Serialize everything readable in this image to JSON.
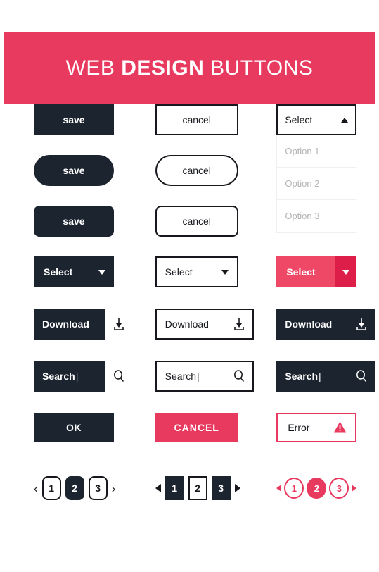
{
  "colors": {
    "pink": "#e8395f",
    "pink_light": "#ef4866",
    "pink_dark": "#dd1e48",
    "dark": "#1c2430",
    "outline": "#16181d",
    "option_text": "#b4b4b4",
    "white": "#ffffff"
  },
  "banner": {
    "title_part1": "WEB ",
    "title_part2": "DESIGN",
    "title_part3": " BUTTONS"
  },
  "buttons": {
    "save_label": "save",
    "cancel_label": "cancel",
    "select_label": "Select",
    "download_label": "Download",
    "search_value": "Search",
    "ok_label": "OK",
    "cancel_caps_label": "CANCEL",
    "error_label": "Error"
  },
  "dropdown_open": {
    "value": "Select",
    "arrow": "triangle-up",
    "options": [
      "Option 1",
      "Option 2",
      "Option 3"
    ]
  },
  "icons": {
    "download": "download-icon",
    "search": "search-icon",
    "warning": "warning-triangle-icon",
    "chevron_left": "‹",
    "chevron_right": "›",
    "triangle_up": "triangle-up-icon",
    "triangle_down": "triangle-down-icon"
  },
  "pagination": [
    {
      "style": "rounded-dark",
      "prev": "‹",
      "next": "›",
      "pages": [
        {
          "label": "1",
          "active": false
        },
        {
          "label": "2",
          "active": true
        },
        {
          "label": "3",
          "active": false
        }
      ]
    },
    {
      "style": "square-dark",
      "prev": "triangle-left",
      "next": "triangle-right",
      "pages": [
        {
          "label": "1",
          "active": true
        },
        {
          "label": "2",
          "active": false
        },
        {
          "label": "3",
          "active": true
        }
      ]
    },
    {
      "style": "circle-pink",
      "prev": "triangle-left",
      "next": "triangle-right",
      "pages": [
        {
          "label": "1",
          "active": false
        },
        {
          "label": "2",
          "active": true
        },
        {
          "label": "3",
          "active": false
        }
      ]
    }
  ]
}
